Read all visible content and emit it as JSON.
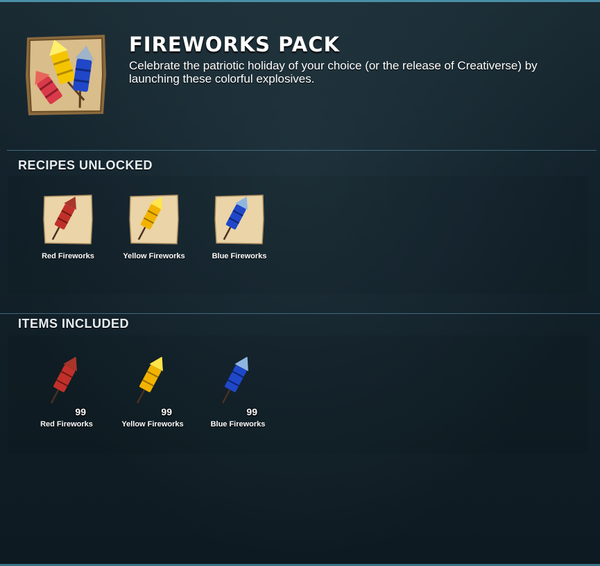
{
  "pack": {
    "title": "FIREWORKS PACK",
    "description": "Celebrate the patriotic holiday of your choice (or the release of Creativerse) by launching these colorful explosives.",
    "icon": "fireworks-pack-icon"
  },
  "recipes": {
    "heading": "RECIPES UNLOCKED",
    "items": [
      {
        "label": "Red Fireworks",
        "icon": "red-fireworks-recipe-icon",
        "color": "#c0302a"
      },
      {
        "label": "Yellow Fireworks",
        "icon": "yellow-fireworks-recipe-icon",
        "color": "#f2c200"
      },
      {
        "label": "Blue Fireworks",
        "icon": "blue-fireworks-recipe-icon",
        "color": "#1f47c8"
      }
    ]
  },
  "included": {
    "heading": "ITEMS INCLUDED",
    "items": [
      {
        "label": "Red Fireworks",
        "count": "99",
        "icon": "red-fireworks-icon",
        "color": "#c0302a"
      },
      {
        "label": "Yellow Fireworks",
        "count": "99",
        "icon": "yellow-fireworks-icon",
        "color": "#f2c200"
      },
      {
        "label": "Blue Fireworks",
        "count": "99",
        "icon": "blue-fireworks-icon",
        "color": "#1f47c8"
      }
    ]
  },
  "colors": {
    "accent_line": "#3d6a7e",
    "parchment": "#e8d3a8",
    "background": "#13222b"
  }
}
